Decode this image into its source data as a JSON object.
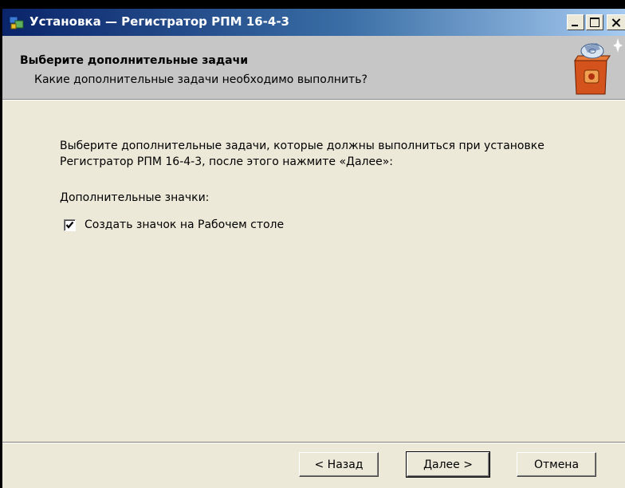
{
  "window": {
    "title": "Установка — Регистратор РПМ 16-4-3"
  },
  "header": {
    "title": "Выберите дополнительные задачи",
    "subtitle": "Какие дополнительные задачи необходимо выполнить?"
  },
  "content": {
    "instruction_line1": "Выберите дополнительные задачи, которые должны выполниться при установке",
    "instruction_line2": "Регистратор РПМ 16-4-3, после этого нажмите «Далее»:",
    "group_label": "Дополнительные значки:",
    "tasks": [
      {
        "label": "Создать значок на Рабочем столе",
        "checked": true
      }
    ]
  },
  "footer": {
    "back_label": "< Назад",
    "next_label": "Далее >",
    "cancel_label": "Отмена"
  },
  "icons": {
    "title_icon": "installer-app-icon",
    "header_image": "setup-box-icon",
    "minimize": "minimize-icon",
    "maximize": "maximize-icon",
    "close": "close-icon",
    "check": "checkmark-icon"
  },
  "colors": {
    "titlebar_start": "#0a246a",
    "titlebar_end": "#a6caf0",
    "header_bg": "#c6c6c6",
    "dialog_bg": "#ece9d8"
  }
}
